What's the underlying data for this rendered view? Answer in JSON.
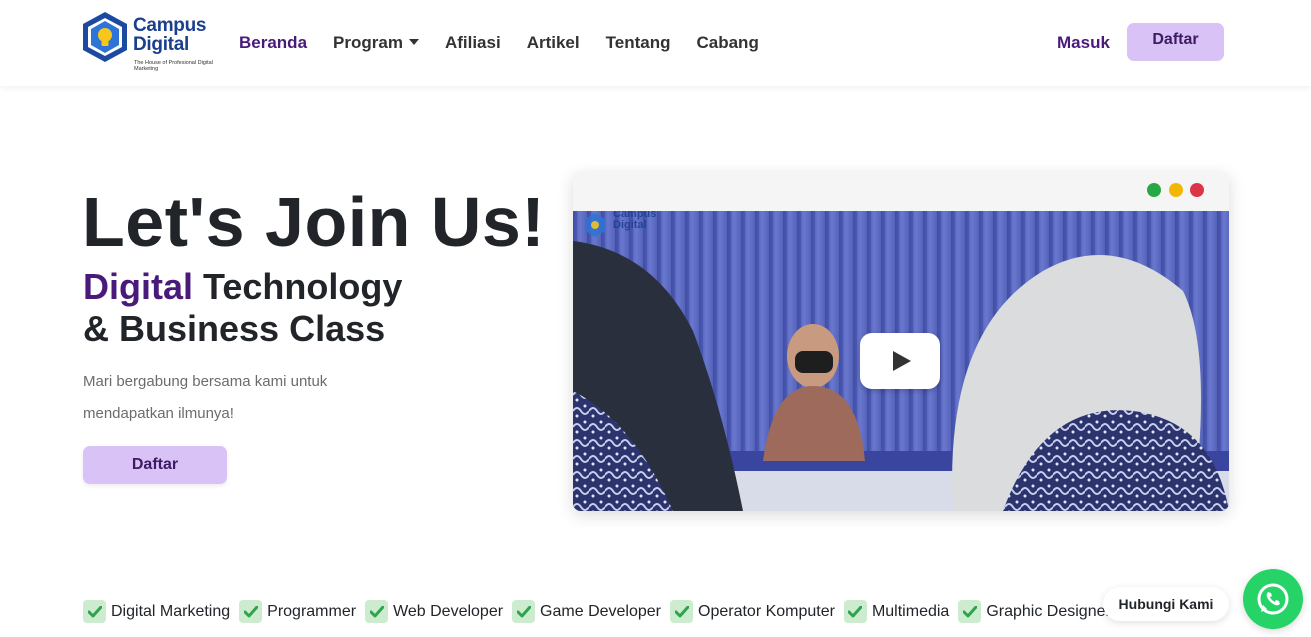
{
  "brand": {
    "line1": "Campus",
    "line2": "Digital",
    "tagline": "The House of Profesional Digital Marketing"
  },
  "nav": {
    "items": [
      {
        "label": "Beranda",
        "active": true
      },
      {
        "label": "Program",
        "dropdown": true
      },
      {
        "label": "Afiliasi"
      },
      {
        "label": "Artikel"
      },
      {
        "label": "Tentang"
      },
      {
        "label": "Cabang"
      }
    ],
    "login_label": "Masuk",
    "register_label": "Daftar"
  },
  "hero": {
    "title": "Let's Join Us!",
    "subtitle_accent": "Digital",
    "subtitle_rest": " Technology",
    "subtitle_line2": "& Business Class",
    "description": "Mari bergabung bersama kami untuk mendapatkan ilmunya!",
    "cta_label": "Daftar"
  },
  "video": {
    "window_dots": [
      "#27a844",
      "#f2b705",
      "#dc3545"
    ],
    "watermark_line1": "Campus",
    "watermark_line2": "Digital",
    "play_icon": "play-icon"
  },
  "features": [
    "Digital Marketing",
    "Programmer",
    "Web Developer",
    "Game Developer",
    "Operator Komputer",
    "Multimedia",
    "Graphic Designer"
  ],
  "contact": {
    "label": "Hubungi Kami",
    "icon": "whatsapp-icon"
  },
  "colors": {
    "accent": "#4a1a7a",
    "button_bg": "#d9c2f6",
    "whatsapp": "#25d366",
    "check_bg": "#cdeccf",
    "check": "#2ea44f"
  }
}
